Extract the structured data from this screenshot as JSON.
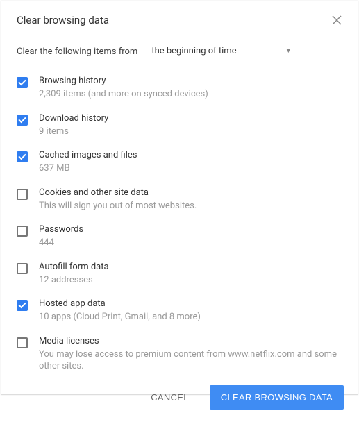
{
  "header": {
    "title": "Clear browsing data"
  },
  "subheader": {
    "label": "Clear the following items from",
    "dropdown_value": "the beginning of time"
  },
  "options": [
    {
      "checked": true,
      "name": "browsing-history",
      "label": "Browsing history",
      "desc": "2,309 items (and more on synced devices)"
    },
    {
      "checked": true,
      "name": "download-history",
      "label": "Download history",
      "desc": "9 items"
    },
    {
      "checked": true,
      "name": "cached-images-files",
      "label": "Cached images and files",
      "desc": "637 MB"
    },
    {
      "checked": false,
      "name": "cookies-site-data",
      "label": "Cookies and other site data",
      "desc": "This will sign you out of most websites."
    },
    {
      "checked": false,
      "name": "passwords",
      "label": "Passwords",
      "desc": "444"
    },
    {
      "checked": false,
      "name": "autofill-form-data",
      "label": "Autofill form data",
      "desc": "12 addresses"
    },
    {
      "checked": true,
      "name": "hosted-app-data",
      "label": "Hosted app data",
      "desc": "10 apps (Cloud Print, Gmail, and 8 more)"
    },
    {
      "checked": false,
      "name": "media-licenses",
      "label": "Media licenses",
      "desc": "You may lose access to premium content from www.netflix.com and some other sites."
    }
  ],
  "footer": {
    "cancel_label": "Cancel",
    "clear_label": "Clear Browsing Data"
  }
}
